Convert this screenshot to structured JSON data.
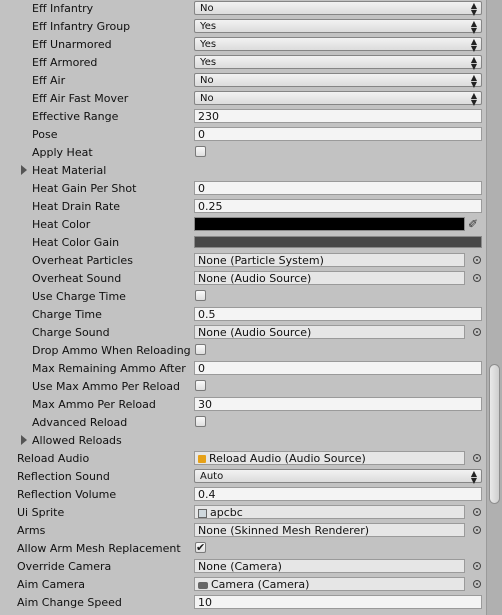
{
  "rows": [
    {
      "label": "Eff Infantry",
      "type": "dropdown",
      "value": "No"
    },
    {
      "label": "Eff Infantry Group",
      "type": "dropdown",
      "value": "Yes"
    },
    {
      "label": "Eff Unarmored",
      "type": "dropdown",
      "value": "Yes"
    },
    {
      "label": "Eff Armored",
      "type": "dropdown",
      "value": "Yes"
    },
    {
      "label": "Eff Air",
      "type": "dropdown",
      "value": "No"
    },
    {
      "label": "Eff Air Fast Mover",
      "type": "dropdown",
      "value": "No"
    },
    {
      "label": "Effective Range",
      "type": "text",
      "value": "230"
    },
    {
      "label": "Pose",
      "type": "text",
      "value": "0"
    },
    {
      "label": "Apply Heat",
      "type": "checkbox",
      "checked": false
    },
    {
      "label": "Heat Material",
      "type": "foldout"
    },
    {
      "label": "Heat Gain Per Shot",
      "type": "text",
      "value": "0"
    },
    {
      "label": "Heat Drain Rate",
      "type": "text",
      "value": "0.25"
    },
    {
      "label": "Heat Color",
      "type": "color",
      "color": "#000000"
    },
    {
      "label": "Heat Color Gain",
      "type": "gain",
      "color": "#484848"
    },
    {
      "label": "Overheat Particles",
      "type": "object",
      "value": "None (Particle System)"
    },
    {
      "label": "Overheat Sound",
      "type": "object",
      "value": "None (Audio Source)"
    },
    {
      "label": "Use Charge Time",
      "type": "checkbox",
      "checked": false
    },
    {
      "label": "Charge Time",
      "type": "text",
      "value": "0.5"
    },
    {
      "label": "Charge Sound",
      "type": "object",
      "value": "None (Audio Source)"
    },
    {
      "label": "Drop Ammo When Reloading",
      "type": "checkbox",
      "checked": false
    },
    {
      "label": "Max Remaining Ammo After",
      "type": "text",
      "value": "0"
    },
    {
      "label": "Use Max Ammo Per Reload",
      "type": "checkbox",
      "checked": false
    },
    {
      "label": "Max Ammo Per Reload",
      "type": "text",
      "value": "30"
    },
    {
      "label": "Advanced Reload",
      "type": "checkbox",
      "checked": false
    },
    {
      "label": "Allowed Reloads",
      "type": "foldout"
    },
    {
      "label": "Reload Audio",
      "type": "object",
      "value": "Reload Audio (Audio Source)",
      "icon": "audio-source-icon",
      "top": true
    },
    {
      "label": "Reflection Sound",
      "type": "dropdown",
      "value": "Auto",
      "top": true
    },
    {
      "label": "Reflection Volume",
      "type": "text",
      "value": "0.4",
      "top": true
    },
    {
      "label": "Ui Sprite",
      "type": "object",
      "value": "apcbc",
      "icon": "sprite-icon",
      "top": true
    },
    {
      "label": "Arms",
      "type": "object",
      "value": "None (Skinned Mesh Renderer)",
      "top": true
    },
    {
      "label": "Allow Arm Mesh Replacement",
      "type": "checkbox",
      "checked": true,
      "top": true
    },
    {
      "label": "Override Camera",
      "type": "object",
      "value": "None (Camera)",
      "top": true
    },
    {
      "label": "Aim Camera",
      "type": "object",
      "value": "Camera (Camera)",
      "icon": "camera-icon",
      "top": true
    },
    {
      "label": "Aim Change Speed",
      "type": "text",
      "value": "10",
      "top": true
    }
  ],
  "colors": {
    "panel": "#c2c2c2",
    "heat_color": "#000000",
    "heat_gain": "#484848",
    "audio_icon": "#e6a118"
  },
  "icons": {
    "dropdown": "up-down-arrows-icon",
    "picker": "object-picker-icon",
    "eyedropper": "eyedropper-icon",
    "foldout": "foldout-arrow-icon"
  }
}
